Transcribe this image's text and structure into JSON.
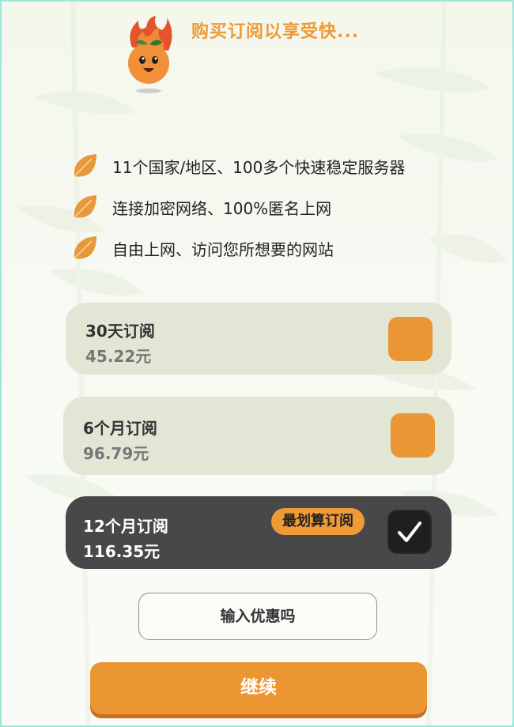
{
  "header": {
    "title": "购买订阅以享受快..."
  },
  "features": [
    {
      "icon": "leaf-icon",
      "text": "11个国家/地区、100多个快速稳定服务器"
    },
    {
      "icon": "leaf-icon",
      "text": "连接加密网络、100%匿名上网"
    },
    {
      "icon": "leaf-icon",
      "text": "自由上网、访问您所想要的网站"
    }
  ],
  "plans": [
    {
      "title": "30天订阅",
      "price": "45.22元",
      "selected": false
    },
    {
      "title": "6个月订阅",
      "price": "96.79元",
      "selected": false
    },
    {
      "title": "12个月订阅",
      "price": "116.35元",
      "selected": true,
      "badge": "最划算订阅"
    }
  ],
  "promo": {
    "label": "输入优惠吗"
  },
  "continue": {
    "label": "继续"
  },
  "colors": {
    "accent": "#ec9633",
    "selected_card": "#48484a",
    "card": "#e2e7d5"
  }
}
